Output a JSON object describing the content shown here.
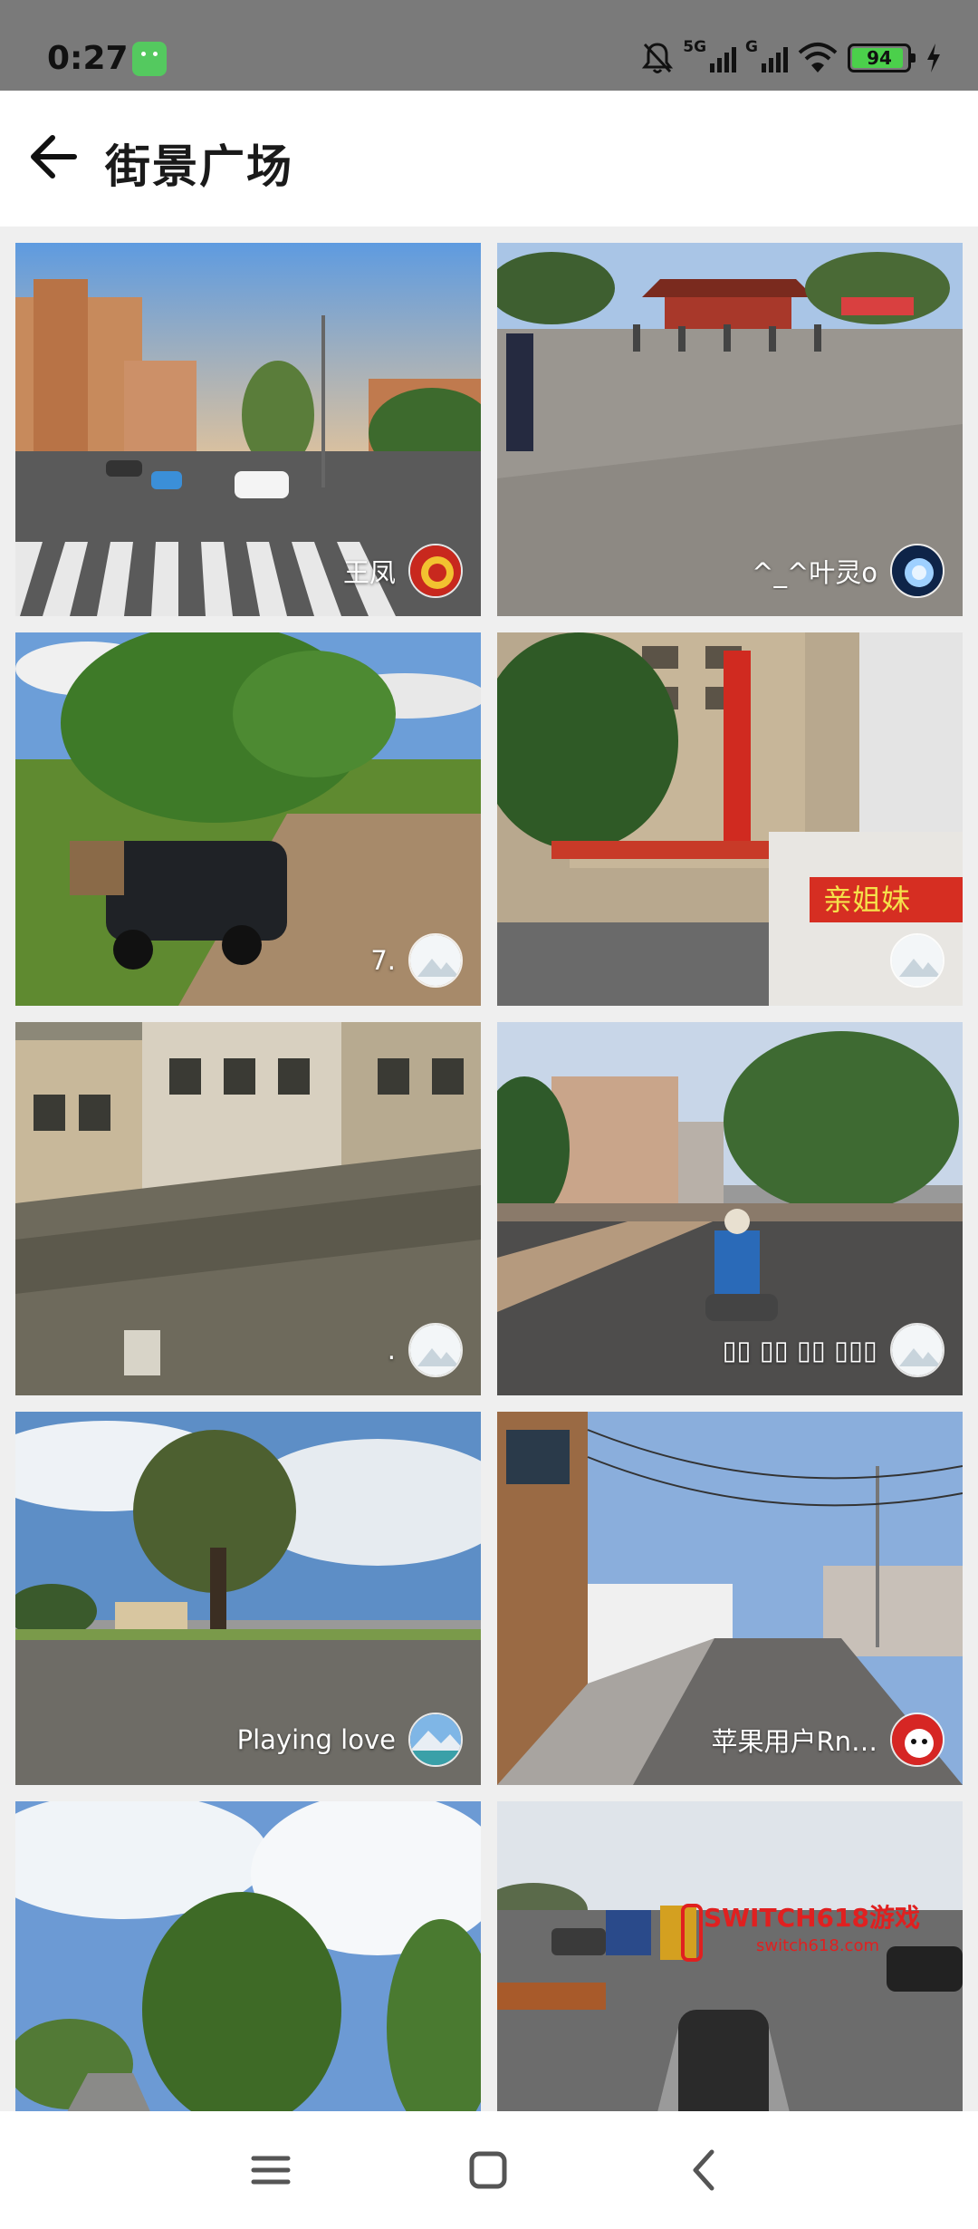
{
  "status_bar": {
    "time": "0:27",
    "sim1_label": "5G",
    "sim2_label": "G",
    "battery_level": "94",
    "battery_percent": 94,
    "colors": {
      "bar_bg": "#7a7a7a",
      "battery_fill": "#4bd04b",
      "android_icon": "#54c95f"
    }
  },
  "header": {
    "title": "街景广场",
    "back_icon": "back-arrow-icon"
  },
  "feed": {
    "items": [
      {
        "owner": "王凤",
        "avatar": "emblem-avatar",
        "scene": "city-crosswalk"
      },
      {
        "owner": "^_^叶灵o",
        "avatar": "blue-swirl-avatar",
        "scene": "temple-plaza"
      },
      {
        "owner": "7.",
        "avatar": "default-mountain-avatar",
        "scene": "dirt-road-car"
      },
      {
        "owner": "",
        "avatar": "default-mountain-avatar",
        "scene": "school-gate-banner",
        "banner_text": "亲姐妹"
      },
      {
        "owner": ".",
        "avatar": "default-mountain-avatar",
        "scene": "old-wall"
      },
      {
        "owner": "▯▯ ▯▯ ▯▯ ▯▯▯",
        "avatar": "default-mountain-avatar",
        "scene": "street-scooter"
      },
      {
        "owner": "Playing love",
        "avatar": "mountain-lake-avatar",
        "scene": "rural-road-tree"
      },
      {
        "owner": "苹果用户Rn…",
        "avatar": "red-cartoon-avatar",
        "scene": "village-street"
      },
      {
        "owner": "",
        "avatar": "",
        "scene": "trees-sky"
      },
      {
        "owner": "",
        "avatar": "",
        "scene": "parking-lot",
        "watermark": "SWITCH618游戏",
        "watermark_sub": "switch618.com"
      }
    ]
  },
  "nav_bar": {
    "icons": [
      "menu-icon",
      "home-icon",
      "back-icon"
    ]
  }
}
